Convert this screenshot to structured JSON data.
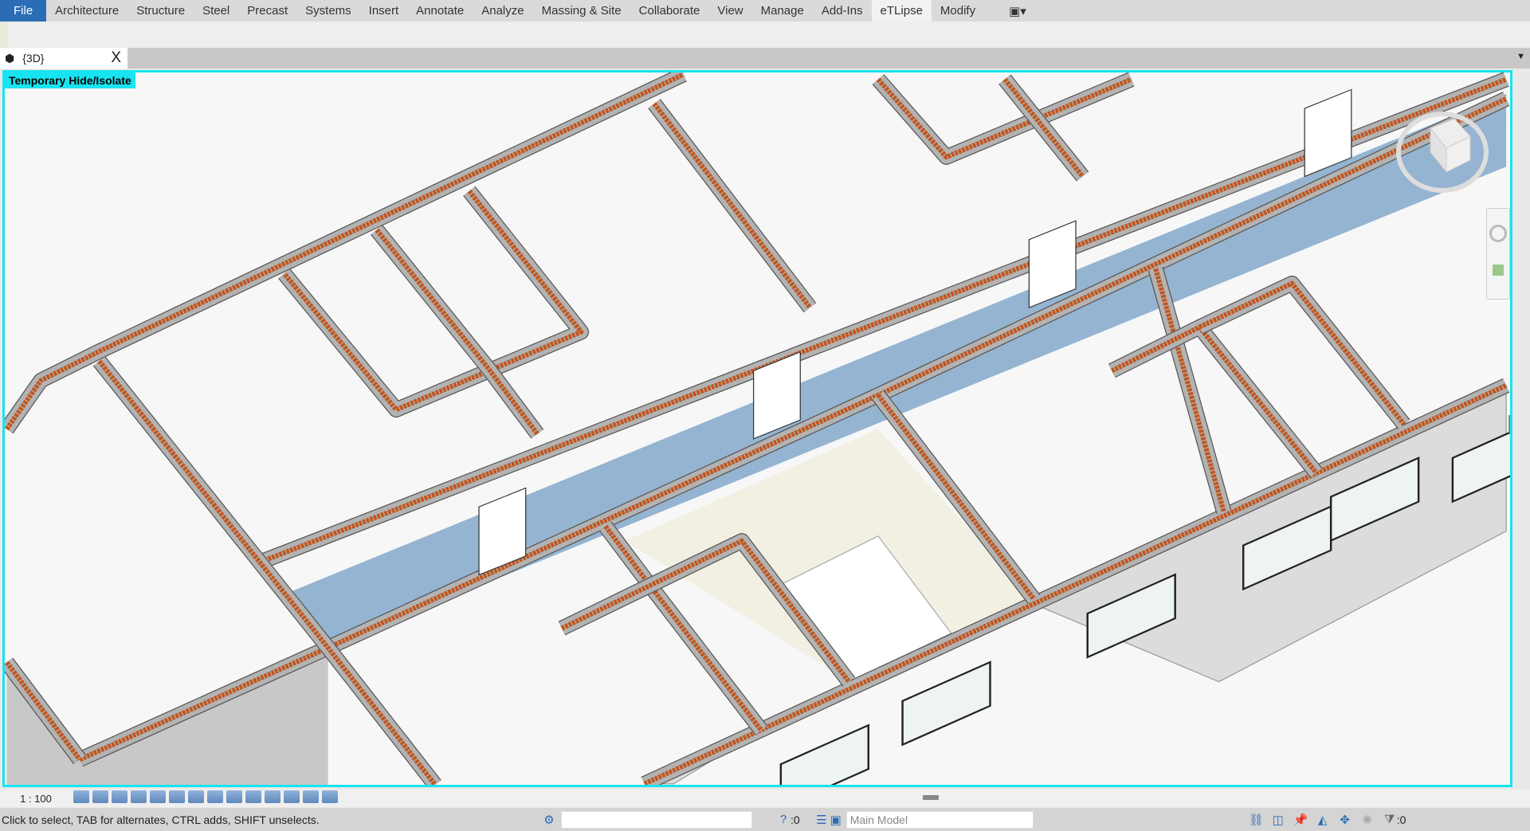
{
  "menu": {
    "items": [
      "File",
      "Architecture",
      "Structure",
      "Steel",
      "Precast",
      "Systems",
      "Insert",
      "Annotate",
      "Analyze",
      "Massing & Site",
      "Collaborate",
      "View",
      "Manage",
      "Add-Ins",
      "eTLipse",
      "Modify"
    ],
    "active": "eTLipse"
  },
  "view_tab": {
    "title": "{3D}",
    "close": "X",
    "icon": "3d-view-icon"
  },
  "viewport": {
    "mode_label": "Temporary Hide/Isolate",
    "border_color": "#17e4f0",
    "wall_color": "#b3b3b3",
    "brick_color": "#c0561f",
    "corridor_color": "#94b4d1"
  },
  "view_control_bar": {
    "scale": "1 : 100"
  },
  "status_bar": {
    "message": "Click to select, TAB for alternates, CTRL adds, SHIFT unselects.",
    "workset_value": "",
    "editable_count": ":0",
    "design_option": "Main Model",
    "filter_count": ":0"
  }
}
